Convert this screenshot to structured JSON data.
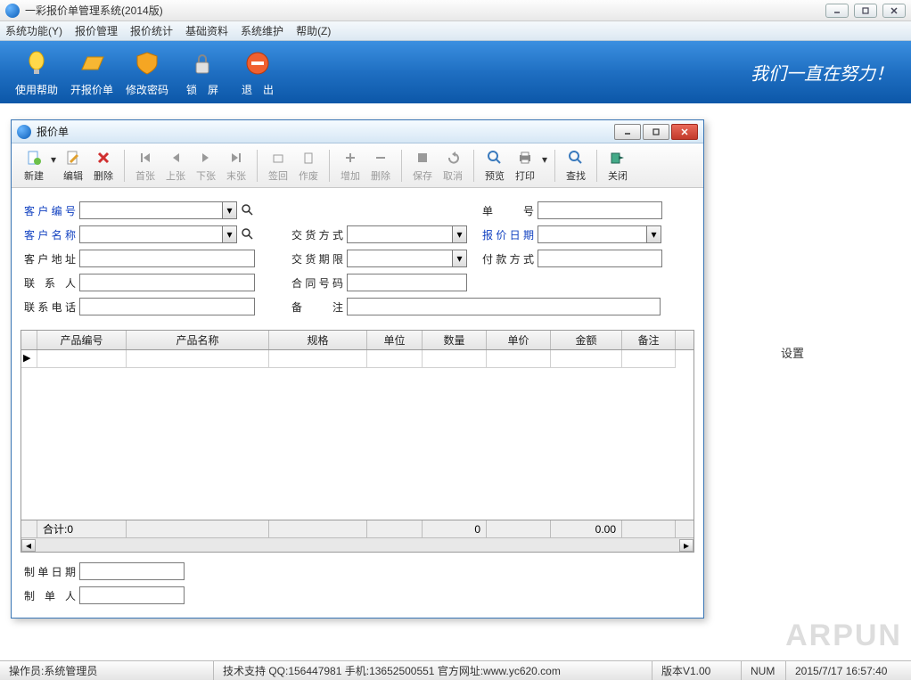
{
  "main": {
    "title": "一彩报价单管理系统(2014版)",
    "menu": [
      "系统功能(Y)",
      "报价管理",
      "报价统计",
      "基础资料",
      "系统维护",
      "帮助(Z)"
    ],
    "toolbar": [
      {
        "label": "使用帮助",
        "icon": "bulb"
      },
      {
        "label": "开报价单",
        "icon": "folder"
      },
      {
        "label": "修改密码",
        "icon": "shield"
      },
      {
        "label": "锁　屏",
        "icon": "lock"
      },
      {
        "label": "退　出",
        "icon": "exit"
      }
    ],
    "slogan": "我们一直在努力！",
    "bg_text": "设置",
    "watermark": "ARPUN"
  },
  "dialog": {
    "title": "报价单",
    "toolbar": [
      {
        "label": "新建",
        "icon": "new",
        "dd": true
      },
      {
        "label": "编辑",
        "icon": "edit"
      },
      {
        "label": "删除",
        "icon": "del"
      },
      {
        "sep": true
      },
      {
        "label": "首张",
        "icon": "first",
        "disabled": true
      },
      {
        "label": "上张",
        "icon": "prev",
        "disabled": true
      },
      {
        "label": "下张",
        "icon": "next",
        "disabled": true
      },
      {
        "label": "末张",
        "icon": "last",
        "disabled": true
      },
      {
        "sep": true
      },
      {
        "label": "签回",
        "icon": "sign",
        "disabled": true
      },
      {
        "label": "作废",
        "icon": "void",
        "disabled": true
      },
      {
        "sep": true
      },
      {
        "label": "增加",
        "icon": "plus",
        "disabled": true
      },
      {
        "label": "删除",
        "icon": "minus",
        "disabled": true
      },
      {
        "sep": true
      },
      {
        "label": "保存",
        "icon": "save",
        "disabled": true
      },
      {
        "label": "取消",
        "icon": "undo",
        "disabled": true
      },
      {
        "sep": true
      },
      {
        "label": "预览",
        "icon": "preview"
      },
      {
        "label": "打印",
        "icon": "print",
        "dd": true
      },
      {
        "sep": true
      },
      {
        "label": "查找",
        "icon": "find"
      },
      {
        "sep": true
      },
      {
        "label": "关闭",
        "icon": "close"
      }
    ],
    "form": {
      "cust_code": "客户编号",
      "cust_name": "客户名称",
      "cust_addr": "客户地址",
      "contact": "联 系 人",
      "phone": "联系电话",
      "bill_no": "单　　号",
      "delivery": "交货方式",
      "quote_date": "报价日期",
      "delivery_term": "交货期限",
      "pay_method": "付款方式",
      "contract_no": "合同号码",
      "remark": "备　　注",
      "make_date": "制单日期",
      "maker": "制 单 人"
    },
    "grid": {
      "cols": [
        "",
        "产品编号",
        "产品名称",
        "规格",
        "单位",
        "数量",
        "单价",
        "金额",
        "备注"
      ],
      "widths": [
        18,
        100,
        160,
        110,
        62,
        72,
        72,
        80,
        60
      ],
      "sum_label": "合计:0",
      "sum_qty": "0",
      "sum_amount": "0.00"
    }
  },
  "status": {
    "operator_lbl": "操作员:",
    "operator": "系统管理员",
    "support": "技术支持 QQ:156447981 手机:13652500551 官方网址:www.yc620.com",
    "version": "版本V1.00",
    "num": "NUM",
    "datetime": "2015/7/17 16:57:40"
  }
}
